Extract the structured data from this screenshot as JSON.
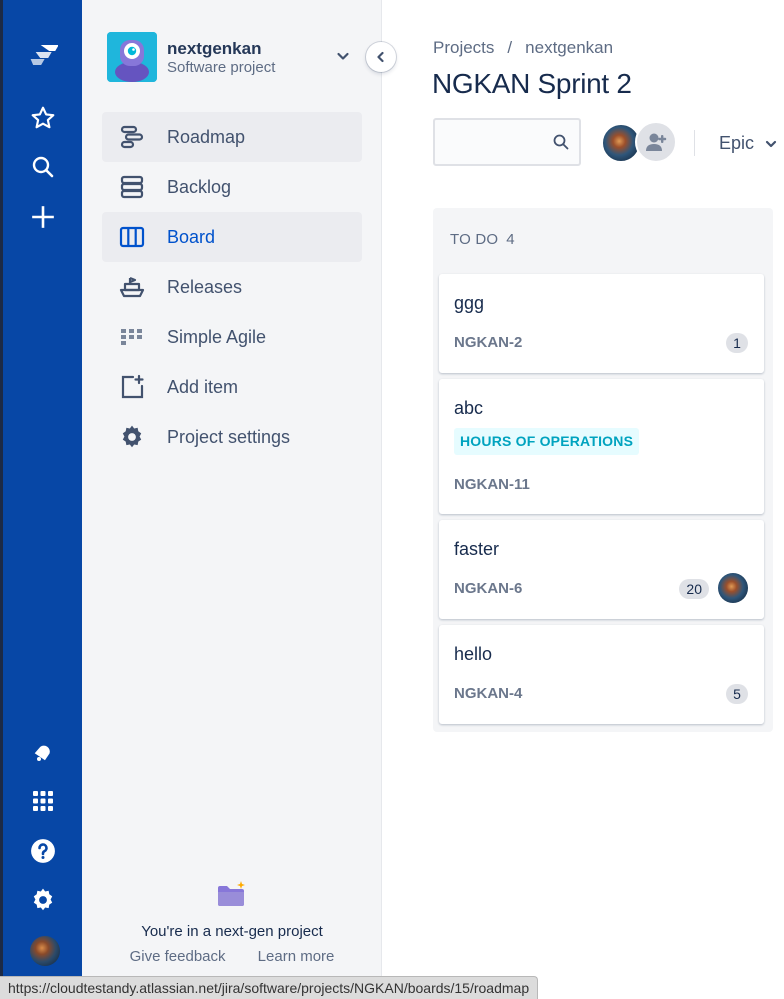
{
  "global_nav": {
    "icons": [
      "jira-logo-icon",
      "star-icon",
      "search-icon",
      "plus-icon",
      "notification-icon",
      "app-switcher-icon",
      "help-icon",
      "settings-icon"
    ]
  },
  "project": {
    "name": "nextgenkan",
    "type": "Software project"
  },
  "sidebar": {
    "items": [
      {
        "label": "Roadmap",
        "icon": "roadmap-icon"
      },
      {
        "label": "Backlog",
        "icon": "backlog-icon"
      },
      {
        "label": "Board",
        "icon": "board-icon"
      },
      {
        "label": "Releases",
        "icon": "releases-icon"
      },
      {
        "label": "Simple Agile",
        "icon": "simple-agile-icon"
      },
      {
        "label": "Add item",
        "icon": "add-item-icon"
      },
      {
        "label": "Project settings",
        "icon": "gear-icon"
      }
    ],
    "active": "Board",
    "hovered": "Roadmap",
    "footer_text": "You're in a next-gen project",
    "give_feedback": "Give feedback",
    "learn_more": "Learn more"
  },
  "breadcrumb": {
    "items": [
      "Projects",
      "nextgenkan"
    ],
    "separator": "/"
  },
  "page_title": "NGKAN Sprint 2",
  "toolbar": {
    "search_value": "",
    "epic_label": "Epic"
  },
  "board": {
    "column": {
      "title": "TO DO",
      "count": "4",
      "cards": [
        {
          "title": "ggg",
          "key": "NGKAN-2",
          "badge": "1"
        },
        {
          "title": "abc",
          "key": "NGKAN-11",
          "epic": "HOURS OF OPERATIONS"
        },
        {
          "title": "faster",
          "key": "NGKAN-6",
          "badge": "20",
          "assignee": true
        },
        {
          "title": "hello",
          "key": "NGKAN-4",
          "badge": "5"
        }
      ]
    }
  },
  "colors": {
    "global_nav_bg": "#0747A6",
    "sidebar_bg": "#F4F5F7",
    "active_text": "#0052CC",
    "epic_bg": "#E6FCFF",
    "epic_text": "#00A3BF"
  },
  "status_url": "https://cloudtestandy.atlassian.net/jira/software/projects/NGKAN/boards/15/roadmap"
}
